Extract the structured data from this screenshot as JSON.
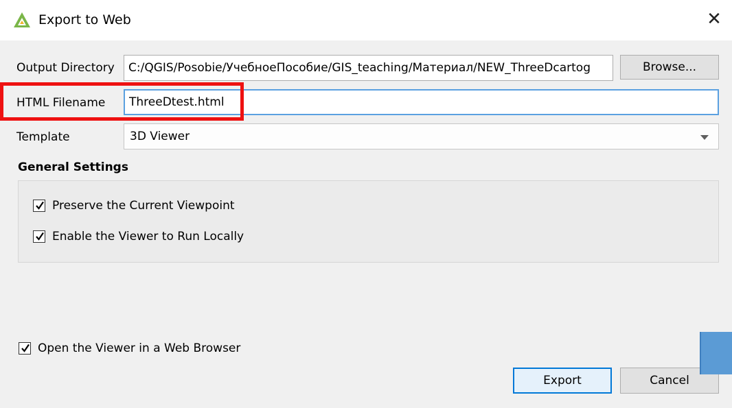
{
  "window": {
    "title": "Export to Web",
    "close_symbol": "✕"
  },
  "form": {
    "output_directory_label": "Output Directory",
    "output_directory_value": "C:/QGIS/Posobie/УчебноеПособие/GIS_teaching/Материал/NEW_ThreeDcartog",
    "browse_label": "Browse...",
    "html_filename_label": "HTML Filename",
    "html_filename_value": "ThreeDtest.html",
    "template_label": "Template",
    "template_value": "3D Viewer"
  },
  "general_settings": {
    "title": "General Settings",
    "options": [
      {
        "label": "Preserve the Current Viewpoint",
        "checked": true
      },
      {
        "label": "Enable the Viewer to Run Locally",
        "checked": true
      }
    ]
  },
  "open_in_browser": {
    "label": "Open the Viewer in a Web Browser",
    "checked": true
  },
  "buttons": {
    "export": "Export",
    "cancel": "Cancel"
  },
  "colors": {
    "highlight": "#ee1111",
    "accent": "#0078d7",
    "app_icon": "#6aa84f"
  }
}
